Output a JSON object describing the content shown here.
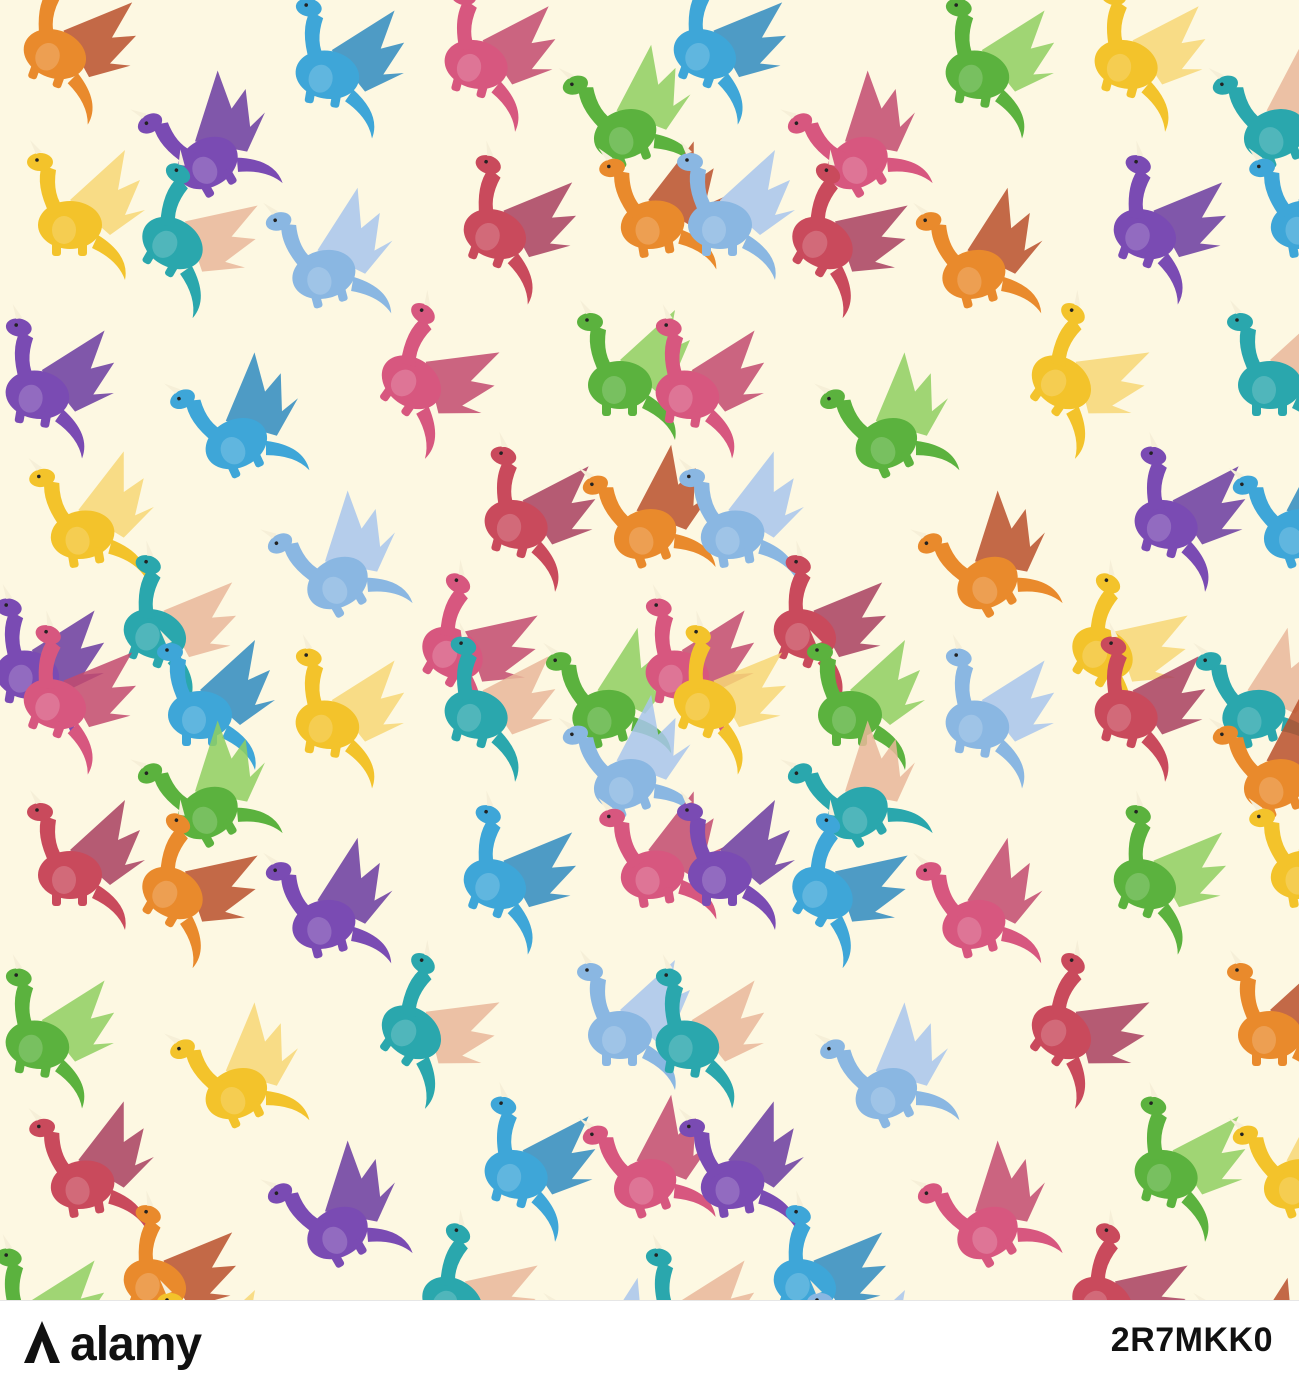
{
  "footer": {
    "brand": "alamy",
    "image_id": "2R7MKK0"
  },
  "colors": {
    "background": "#fdf8e2",
    "palette": [
      "#e98a2c",
      "#7a4bb3",
      "#3ea6d8",
      "#d7577f",
      "#5bb23e",
      "#f3c32b",
      "#2aa7ad",
      "#8ab7e2",
      "#b9502b"
    ]
  },
  "pattern": {
    "subject": "cartoon dragons",
    "dragons": [
      {
        "color": "#e98a2c",
        "wing": "#b9502b"
      },
      {
        "color": "#7a4bb3",
        "wing": "#6a3ba0"
      },
      {
        "color": "#3ea6d8",
        "wing": "#2f8bc0"
      },
      {
        "color": "#d7577f",
        "wing": "#c24a6f"
      },
      {
        "color": "#5bb23e",
        "wing": "#8fcf60"
      },
      {
        "color": "#f3c32b",
        "wing": "#f7d775"
      },
      {
        "color": "#2aa7ad",
        "wing": "#e9b79a"
      },
      {
        "color": "#8ab7e2",
        "wing": "#a8c6ec"
      },
      {
        "color": "#c94a5c",
        "wing": "#a8405f"
      }
    ]
  }
}
